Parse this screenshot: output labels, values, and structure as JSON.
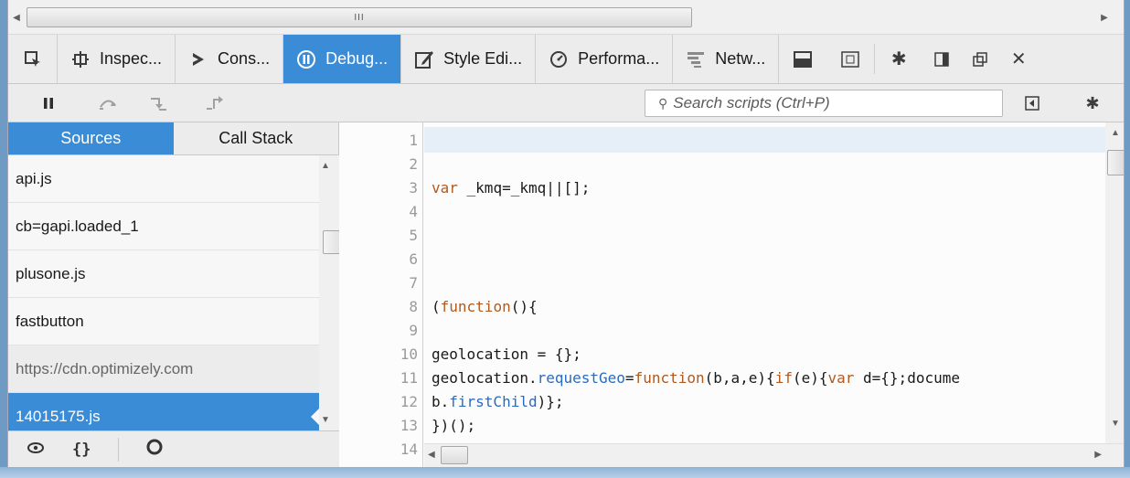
{
  "top_scrollbar": {
    "left_arrow": "◀",
    "right_arrow": "▶",
    "grip": "III"
  },
  "tabs": [
    {
      "label": "Inspec...",
      "icon": "inspector-icon"
    },
    {
      "label": "Cons...",
      "icon": "console-icon"
    },
    {
      "label": "Debug...",
      "icon": "debugger-icon",
      "active": true
    },
    {
      "label": "Style Edi...",
      "icon": "style-editor-icon"
    },
    {
      "label": "Performa...",
      "icon": "performance-icon"
    },
    {
      "label": "Netw...",
      "icon": "network-icon"
    }
  ],
  "search": {
    "placeholder": "Search scripts (Ctrl+P)"
  },
  "sidebar": {
    "tabs": [
      "Sources",
      "Call Stack"
    ],
    "sources": [
      {
        "label": "api.js"
      },
      {
        "label": "cb=gapi.loaded_1"
      },
      {
        "label": "plusone.js"
      },
      {
        "label": "fastbutton"
      },
      {
        "label": "https://cdn.optimizely.com",
        "group": true
      },
      {
        "label": "14015175.js",
        "selected": true
      }
    ]
  },
  "editor": {
    "line_numbers": [
      "1",
      "2",
      "3",
      "4",
      "5",
      "6",
      "7",
      "8",
      "9",
      "10",
      "11",
      "12",
      "13",
      "14"
    ],
    "lines": [
      "",
      "",
      "var _kmq=_kmq||[];",
      "",
      "",
      "",
      "",
      "(function(){",
      "",
      "geolocation = {};",
      "geolocation.requestGeo=function(b,a,e){if(e){var d={};docume",
      "b.firstChild)};",
      "})();",
      ""
    ]
  },
  "colors": {
    "accent": "#3b8cd7",
    "keyword": "#b05a1e",
    "property": "#2a6bbd"
  }
}
